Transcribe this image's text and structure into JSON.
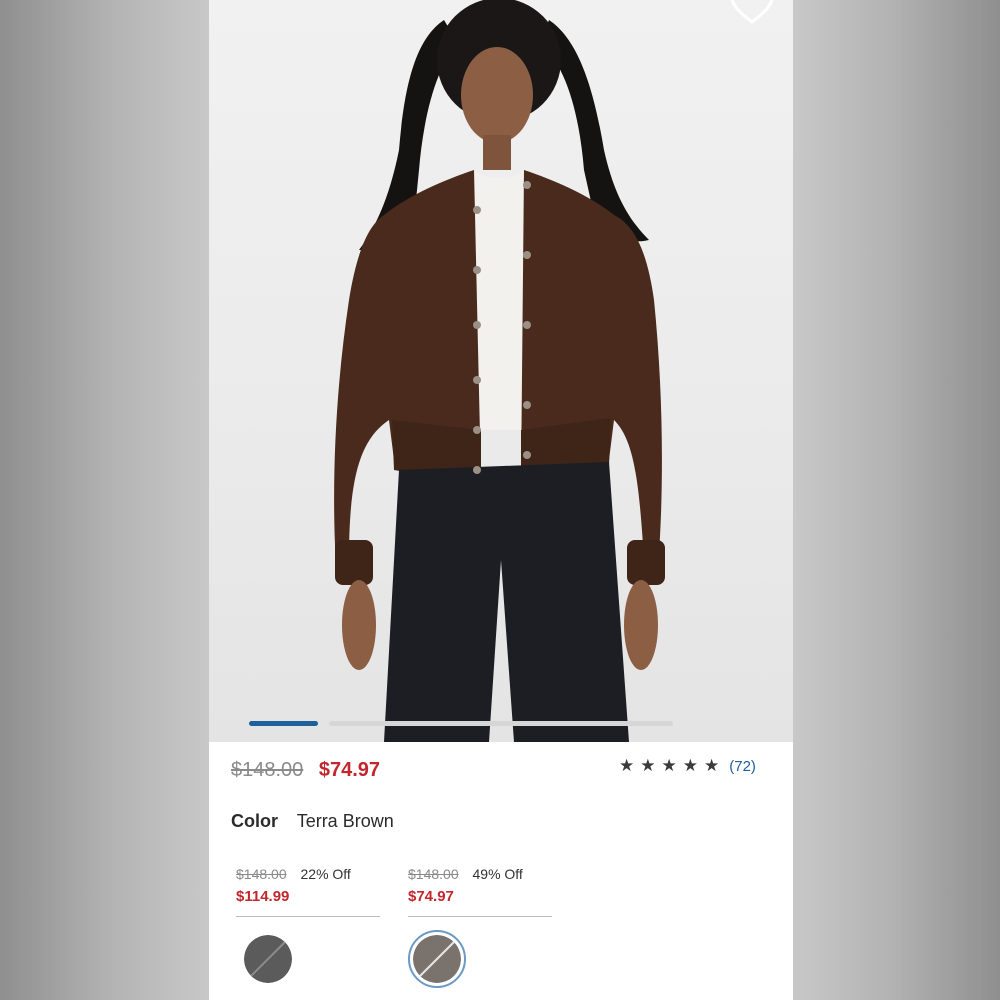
{
  "product": {
    "original_price": "$148.00",
    "sale_price": "$74.97",
    "rating_stars": 5,
    "rating_count": "(72)"
  },
  "color": {
    "label": "Color",
    "value": "Terra Brown"
  },
  "price_options": [
    {
      "original": "$148.00",
      "discount": "22% Off",
      "price": "$114.99",
      "swatch_color": "#5b5b5b",
      "selected": false
    },
    {
      "original": "$148.00",
      "discount": "49% Off",
      "price": "$74.97",
      "swatch_color": "#7a726d",
      "selected": true
    }
  ],
  "carousel": {
    "slide_count": 2,
    "current_slide": 1
  },
  "colors": {
    "accent": "#1f5f9c",
    "sale": "#c1272d",
    "jacket": "#4a2a1d",
    "jeans": "#1d1e24"
  }
}
